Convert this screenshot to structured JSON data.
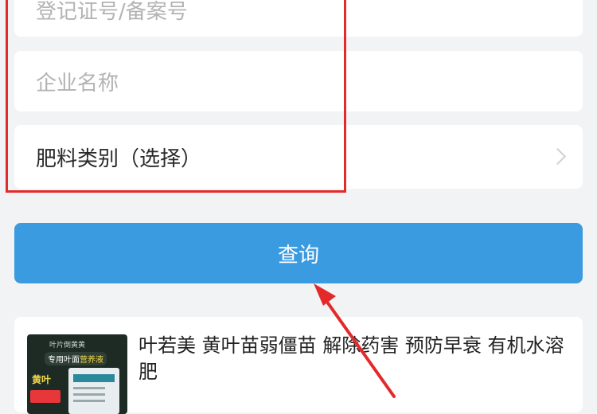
{
  "form": {
    "registration_placeholder": "登记证号/备案号",
    "company_placeholder": "企业名称",
    "category_label": "肥料类别（选择）"
  },
  "query_button": "查询",
  "product": {
    "title": "叶若美 黄叶苗弱僵苗 解除药害 预防早衰 有机水溶肥",
    "image_text_top": "叶片倒黄黄",
    "image_text_badge": "专用叶面",
    "image_text_badge_hl": "营养液",
    "image_tag": "黄叶"
  },
  "colors": {
    "accent": "#3b9be0",
    "annotation": "#e32a2a",
    "background": "#f2f3f5"
  },
  "icons": [
    "chevron-right-icon"
  ]
}
